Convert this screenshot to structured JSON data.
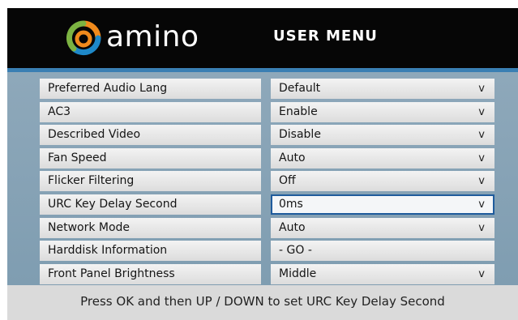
{
  "header": {
    "logo_text": "amino",
    "menu_title": "USER MENU"
  },
  "menu": {
    "selected_index": 5,
    "rows": [
      {
        "label": "Preferred Audio Lang",
        "value": "Default",
        "arrow": "v"
      },
      {
        "label": "AC3",
        "value": "Enable",
        "arrow": "v"
      },
      {
        "label": "Described Video",
        "value": "Disable",
        "arrow": "v"
      },
      {
        "label": "Fan Speed",
        "value": "Auto",
        "arrow": "v"
      },
      {
        "label": "Flicker Filtering",
        "value": "Off",
        "arrow": "v"
      },
      {
        "label": "URC Key Delay Second",
        "value": "0ms",
        "arrow": "v"
      },
      {
        "label": "Network Mode",
        "value": "Auto",
        "arrow": "v"
      },
      {
        "label": "Harddisk Information",
        "value": "- GO -",
        "arrow": ""
      },
      {
        "label": "Front Panel Brightness",
        "value": "Middle",
        "arrow": "v"
      }
    ]
  },
  "footer": {
    "hint": "Press OK and then UP / DOWN to set URC Key Delay Second"
  },
  "colors": {
    "header_bg": "#060606",
    "accent": "#3a7fb3",
    "panel_bg": "#8ea8ba",
    "selected_border": "#1f5b9c",
    "logo_orange": "#f08a1c",
    "logo_green": "#7cb342",
    "logo_blue": "#1e88c8"
  }
}
